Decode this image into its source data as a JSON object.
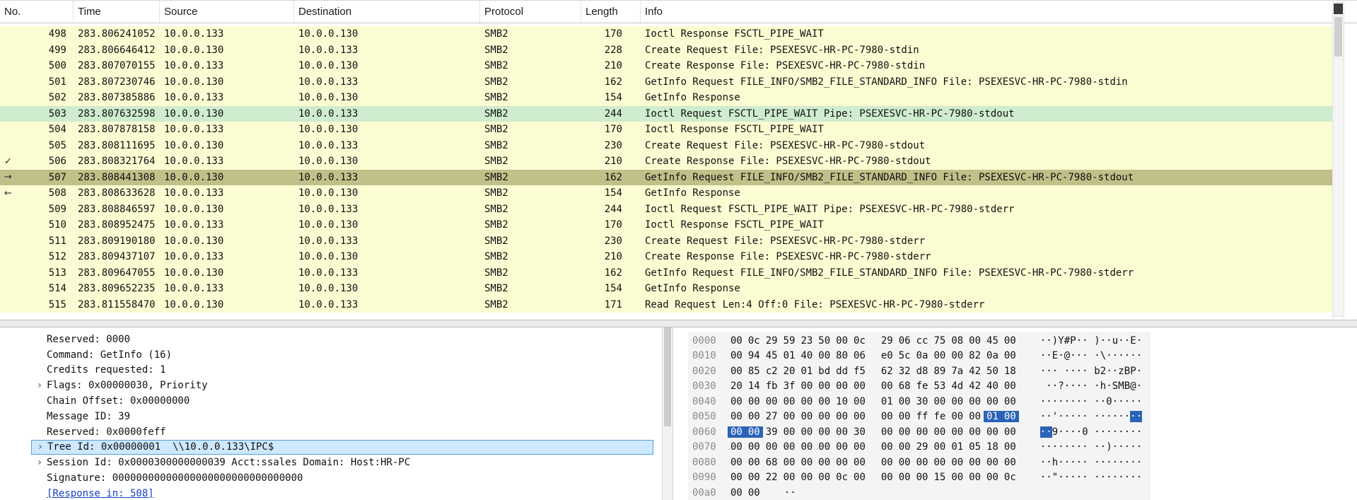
{
  "colors": {
    "row_yellow": "#fcfcd3",
    "row_green": "#cfeccf",
    "row_selected": "#c0c089",
    "detail_selected_bg": "#cde8ff",
    "detail_selected_border": "#56a0e0",
    "hex_highlight_bg": "#2a63b8",
    "hex_highlight_fg": "#ffffff",
    "link_color": "#1941c8",
    "offset_color": "#8a8a8a"
  },
  "icons": {
    "check": "✓",
    "arrow-right": "→",
    "arrow-left": "←",
    "expander": "›"
  },
  "packet_list": {
    "columns": [
      "No.",
      "Time",
      "Source",
      "Destination",
      "Protocol",
      "Length",
      "Info"
    ],
    "rows": [
      {
        "no": "498",
        "time": "283.806241052",
        "src": "10.0.0.133",
        "dst": "10.0.0.130",
        "proto": "SMB2",
        "len": "170",
        "info": "Ioctl Response FSCTL_PIPE_WAIT",
        "state": "",
        "marker": ""
      },
      {
        "no": "499",
        "time": "283.806646412",
        "src": "10.0.0.130",
        "dst": "10.0.0.133",
        "proto": "SMB2",
        "len": "228",
        "info": "Create Request File: PSEXESVC-HR-PC-7980-stdin",
        "state": "",
        "marker": ""
      },
      {
        "no": "500",
        "time": "283.807070155",
        "src": "10.0.0.133",
        "dst": "10.0.0.130",
        "proto": "SMB2",
        "len": "210",
        "info": "Create Response File: PSEXESVC-HR-PC-7980-stdin",
        "state": "",
        "marker": ""
      },
      {
        "no": "501",
        "time": "283.807230746",
        "src": "10.0.0.130",
        "dst": "10.0.0.133",
        "proto": "SMB2",
        "len": "162",
        "info": "GetInfo Request FILE_INFO/SMB2_FILE_STANDARD_INFO File: PSEXESVC-HR-PC-7980-stdin",
        "state": "",
        "marker": ""
      },
      {
        "no": "502",
        "time": "283.807385886",
        "src": "10.0.0.133",
        "dst": "10.0.0.130",
        "proto": "SMB2",
        "len": "154",
        "info": "GetInfo Response",
        "state": "",
        "marker": ""
      },
      {
        "no": "503",
        "time": "283.807632598",
        "src": "10.0.0.130",
        "dst": "10.0.0.133",
        "proto": "SMB2",
        "len": "244",
        "info": "Ioctl Request FSCTL_PIPE_WAIT Pipe: PSEXESVC-HR-PC-7980-stdout",
        "state": "green",
        "marker": ""
      },
      {
        "no": "504",
        "time": "283.807878158",
        "src": "10.0.0.133",
        "dst": "10.0.0.130",
        "proto": "SMB2",
        "len": "170",
        "info": "Ioctl Response FSCTL_PIPE_WAIT",
        "state": "",
        "marker": ""
      },
      {
        "no": "505",
        "time": "283.808111695",
        "src": "10.0.0.130",
        "dst": "10.0.0.133",
        "proto": "SMB2",
        "len": "230",
        "info": "Create Request File: PSEXESVC-HR-PC-7980-stdout",
        "state": "",
        "marker": ""
      },
      {
        "no": "506",
        "time": "283.808321764",
        "src": "10.0.0.133",
        "dst": "10.0.0.130",
        "proto": "SMB2",
        "len": "210",
        "info": "Create Response File: PSEXESVC-HR-PC-7980-stdout",
        "state": "",
        "marker": "check"
      },
      {
        "no": "507",
        "time": "283.808441308",
        "src": "10.0.0.130",
        "dst": "10.0.0.133",
        "proto": "SMB2",
        "len": "162",
        "info": "GetInfo Request FILE_INFO/SMB2_FILE_STANDARD_INFO File: PSEXESVC-HR-PC-7980-stdout",
        "state": "selected",
        "marker": "arrow-right"
      },
      {
        "no": "508",
        "time": "283.808633628",
        "src": "10.0.0.133",
        "dst": "10.0.0.130",
        "proto": "SMB2",
        "len": "154",
        "info": "GetInfo Response",
        "state": "",
        "marker": "arrow-left"
      },
      {
        "no": "509",
        "time": "283.808846597",
        "src": "10.0.0.130",
        "dst": "10.0.0.133",
        "proto": "SMB2",
        "len": "244",
        "info": "Ioctl Request FSCTL_PIPE_WAIT Pipe: PSEXESVC-HR-PC-7980-stderr",
        "state": "",
        "marker": ""
      },
      {
        "no": "510",
        "time": "283.808952475",
        "src": "10.0.0.133",
        "dst": "10.0.0.130",
        "proto": "SMB2",
        "len": "170",
        "info": "Ioctl Response FSCTL_PIPE_WAIT",
        "state": "",
        "marker": ""
      },
      {
        "no": "511",
        "time": "283.809190180",
        "src": "10.0.0.130",
        "dst": "10.0.0.133",
        "proto": "SMB2",
        "len": "230",
        "info": "Create Request File: PSEXESVC-HR-PC-7980-stderr",
        "state": "",
        "marker": ""
      },
      {
        "no": "512",
        "time": "283.809437107",
        "src": "10.0.0.133",
        "dst": "10.0.0.130",
        "proto": "SMB2",
        "len": "210",
        "info": "Create Response File: PSEXESVC-HR-PC-7980-stderr",
        "state": "",
        "marker": ""
      },
      {
        "no": "513",
        "time": "283.809647055",
        "src": "10.0.0.130",
        "dst": "10.0.0.133",
        "proto": "SMB2",
        "len": "162",
        "info": "GetInfo Request FILE_INFO/SMB2_FILE_STANDARD_INFO File: PSEXESVC-HR-PC-7980-stderr",
        "state": "",
        "marker": ""
      },
      {
        "no": "514",
        "time": "283.809652235",
        "src": "10.0.0.133",
        "dst": "10.0.0.130",
        "proto": "SMB2",
        "len": "154",
        "info": "GetInfo Response",
        "state": "",
        "marker": ""
      },
      {
        "no": "515",
        "time": "283.811558470",
        "src": "10.0.0.130",
        "dst": "10.0.0.133",
        "proto": "SMB2",
        "len": "171",
        "info": "Read Request Len:4 Off:0 File: PSEXESVC-HR-PC-7980-stderr",
        "state": "",
        "marker": ""
      }
    ]
  },
  "detail_pane": {
    "lines": [
      {
        "expander": false,
        "text": "Reserved: 0000",
        "selected": false,
        "link": false
      },
      {
        "expander": false,
        "text": "Command: GetInfo (16)",
        "selected": false,
        "link": false
      },
      {
        "expander": false,
        "text": "Credits requested: 1",
        "selected": false,
        "link": false
      },
      {
        "expander": true,
        "text": "Flags: 0x00000030, Priority",
        "selected": false,
        "link": false
      },
      {
        "expander": false,
        "text": "Chain Offset: 0x00000000",
        "selected": false,
        "link": false
      },
      {
        "expander": false,
        "text": "Message ID: 39",
        "selected": false,
        "link": false
      },
      {
        "expander": false,
        "text": "Reserved: 0x0000feff",
        "selected": false,
        "link": false
      },
      {
        "expander": true,
        "text": "Tree Id: 0x00000001  \\\\10.0.0.133\\IPC$",
        "selected": true,
        "link": false
      },
      {
        "expander": true,
        "text": "Session Id: 0x0000300000000039 Acct:ssales Domain: Host:HR-PC",
        "selected": false,
        "link": false
      },
      {
        "expander": false,
        "text": "Signature: 00000000000000000000000000000000",
        "selected": false,
        "link": false
      },
      {
        "expander": false,
        "text": "[Response in: 508]",
        "selected": false,
        "link": true
      }
    ]
  },
  "bytes_pane": {
    "rows": [
      {
        "offset": "0000",
        "bytes": [
          "00",
          "0c",
          "29",
          "59",
          "23",
          "50",
          "00",
          "0c",
          "29",
          "06",
          "cc",
          "75",
          "08",
          "00",
          "45",
          "00"
        ],
        "ascii": "··)Y#P··)··u··E·"
      },
      {
        "offset": "0010",
        "bytes": [
          "00",
          "94",
          "45",
          "01",
          "40",
          "00",
          "80",
          "06",
          "e0",
          "5c",
          "0a",
          "00",
          "00",
          "82",
          "0a",
          "00"
        ],
        "ascii": "··E·@····\\······"
      },
      {
        "offset": "0020",
        "bytes": [
          "00",
          "85",
          "c2",
          "20",
          "01",
          "bd",
          "dd",
          "f5",
          "62",
          "32",
          "d8",
          "89",
          "7a",
          "42",
          "50",
          "18"
        ],
        "ascii": "··· ····b2··zBP·"
      },
      {
        "offset": "0030",
        "bytes": [
          "20",
          "14",
          "fb",
          "3f",
          "00",
          "00",
          "00",
          "00",
          "00",
          "68",
          "fe",
          "53",
          "4d",
          "42",
          "40",
          "00"
        ],
        "ascii": " ··?·····h·SMB@·"
      },
      {
        "offset": "0040",
        "bytes": [
          "00",
          "00",
          "00",
          "00",
          "00",
          "00",
          "10",
          "00",
          "01",
          "00",
          "30",
          "00",
          "00",
          "00",
          "00",
          "00"
        ],
        "ascii": "··········0·····"
      },
      {
        "offset": "0050",
        "bytes": [
          "00",
          "00",
          "27",
          "00",
          "00",
          "00",
          "00",
          "00",
          "00",
          "00",
          "ff",
          "fe",
          "00",
          "00",
          "01",
          "00"
        ],
        "ascii": "··'·············"
      },
      {
        "offset": "0060",
        "bytes": [
          "00",
          "00",
          "39",
          "00",
          "00",
          "00",
          "00",
          "30",
          "00",
          "00",
          "00",
          "00",
          "00",
          "00",
          "00",
          "00"
        ],
        "ascii": "··9····0········"
      },
      {
        "offset": "0070",
        "bytes": [
          "00",
          "00",
          "00",
          "00",
          "00",
          "00",
          "00",
          "00",
          "00",
          "00",
          "29",
          "00",
          "01",
          "05",
          "18",
          "00"
        ],
        "ascii": "··········)·····"
      },
      {
        "offset": "0080",
        "bytes": [
          "00",
          "00",
          "68",
          "00",
          "00",
          "00",
          "00",
          "00",
          "00",
          "00",
          "00",
          "00",
          "00",
          "00",
          "00",
          "00"
        ],
        "ascii": "··h·············"
      },
      {
        "offset": "0090",
        "bytes": [
          "00",
          "00",
          "22",
          "00",
          "00",
          "00",
          "0c",
          "00",
          "00",
          "00",
          "00",
          "15",
          "00",
          "00",
          "00",
          "0c"
        ],
        "ascii": "··\"·············"
      },
      {
        "offset": "00a0",
        "bytes": [
          "00",
          "00"
        ],
        "ascii": "··"
      }
    ],
    "highlights": [
      {
        "row": 5,
        "start": 14,
        "end": 15
      },
      {
        "row": 6,
        "start": 0,
        "end": 1
      }
    ]
  }
}
